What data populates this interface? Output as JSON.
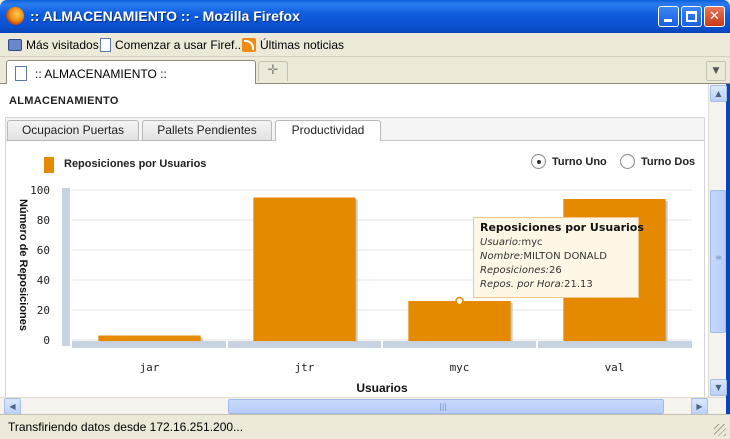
{
  "window": {
    "title": ":: ALMACENAMIENTO :: - Mozilla Firefox",
    "minimize_glyph": "",
    "maximize_glyph": "",
    "close_glyph": "✕"
  },
  "bookmarks": [
    {
      "label": "Más visitados",
      "icon": "bookmarks-folder-icon"
    },
    {
      "label": "Comenzar a usar Firef...",
      "icon": "page-icon"
    },
    {
      "label": "Últimas noticias",
      "icon": "rss-feed-icon"
    }
  ],
  "browser_tab": {
    "label": ":: ALMACENAMIENTO ::",
    "new_tab_glyph": "✛",
    "list_glyph": "▼"
  },
  "page": {
    "heading": "ALMACENAMIENTO",
    "tabs": [
      {
        "label": "Ocupacion Puertas",
        "active": false
      },
      {
        "label": "Pallets Pendientes",
        "active": false
      },
      {
        "label": "Productividad",
        "active": true
      }
    ],
    "legend": "Reposiciones por Usuarios",
    "radios": [
      {
        "label": "Turno Uno",
        "checked": true
      },
      {
        "label": "Turno Dos",
        "checked": false
      }
    ]
  },
  "chart_data": {
    "type": "bar",
    "categories": [
      "jar",
      "jtr",
      "myc",
      "val"
    ],
    "values": [
      3,
      95,
      26,
      94
    ],
    "xlabel": "Usuarios",
    "ylabel": "Número de Reposiciones",
    "ylim": [
      0,
      100
    ],
    "yticks": [
      0,
      20,
      40,
      60,
      80,
      100
    ],
    "grid": true,
    "bar_color": "#e58a00",
    "axis_color": "#c7d3e0"
  },
  "tooltip": {
    "title": "Reposiciones por Usuarios",
    "rows": [
      {
        "key": "Usuario:",
        "value": "myc"
      },
      {
        "key": "Nombre:",
        "value": "MILTON DONALD"
      },
      {
        "key": "Reposiciones:",
        "value": "26"
      },
      {
        "key": "Repos. por Hora:",
        "value": "21.13"
      }
    ]
  },
  "status": "Transfiriendo datos desde 172.16.251.200..."
}
